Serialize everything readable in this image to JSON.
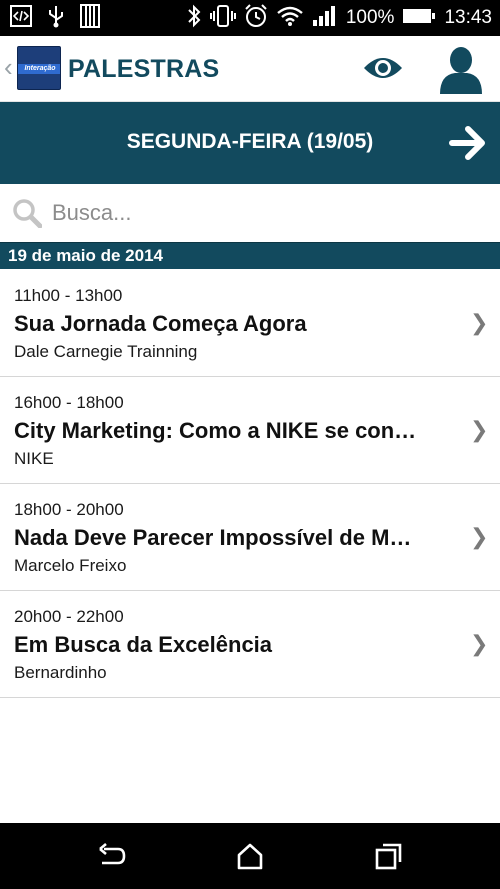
{
  "status_bar": {
    "battery": "100%",
    "time": "13:43",
    "icons": [
      "developer-icon",
      "usb-icon",
      "sd-card-icon",
      "bluetooth-icon",
      "vibrate-icon",
      "alarm-icon",
      "wifi-icon",
      "signal-icon",
      "battery-icon"
    ]
  },
  "app_bar": {
    "title": "PALESTRAS",
    "logo_text": "Interação",
    "actions": [
      "eye-icon",
      "user-icon"
    ]
  },
  "day_nav": {
    "label": "SEGUNDA-FEIRA (19/05)",
    "next_icon": "arrow-right-icon"
  },
  "search": {
    "placeholder": "Busca..."
  },
  "date_header": "19 de maio de 2014",
  "sessions": [
    {
      "time": "11h00 - 13h00",
      "title": "Sua Jornada Começa Agora",
      "speaker": "Dale Carnegie Trainning"
    },
    {
      "time": "16h00 - 18h00",
      "title": "City Marketing: Como a NIKE se con…",
      "speaker": "NIKE"
    },
    {
      "time": "18h00 - 20h00",
      "title": "Nada Deve Parecer Impossível de M…",
      "speaker": "Marcelo Freixo"
    },
    {
      "time": "20h00 - 22h00",
      "title": "Em Busca da Excelência",
      "speaker": "Bernardinho"
    }
  ],
  "chevron": "❯",
  "nav_bar": [
    "back-icon",
    "home-icon",
    "recents-icon"
  ],
  "colors": {
    "primary": "#124a5e",
    "background": "#ffffff",
    "status_bar": "#000000"
  }
}
